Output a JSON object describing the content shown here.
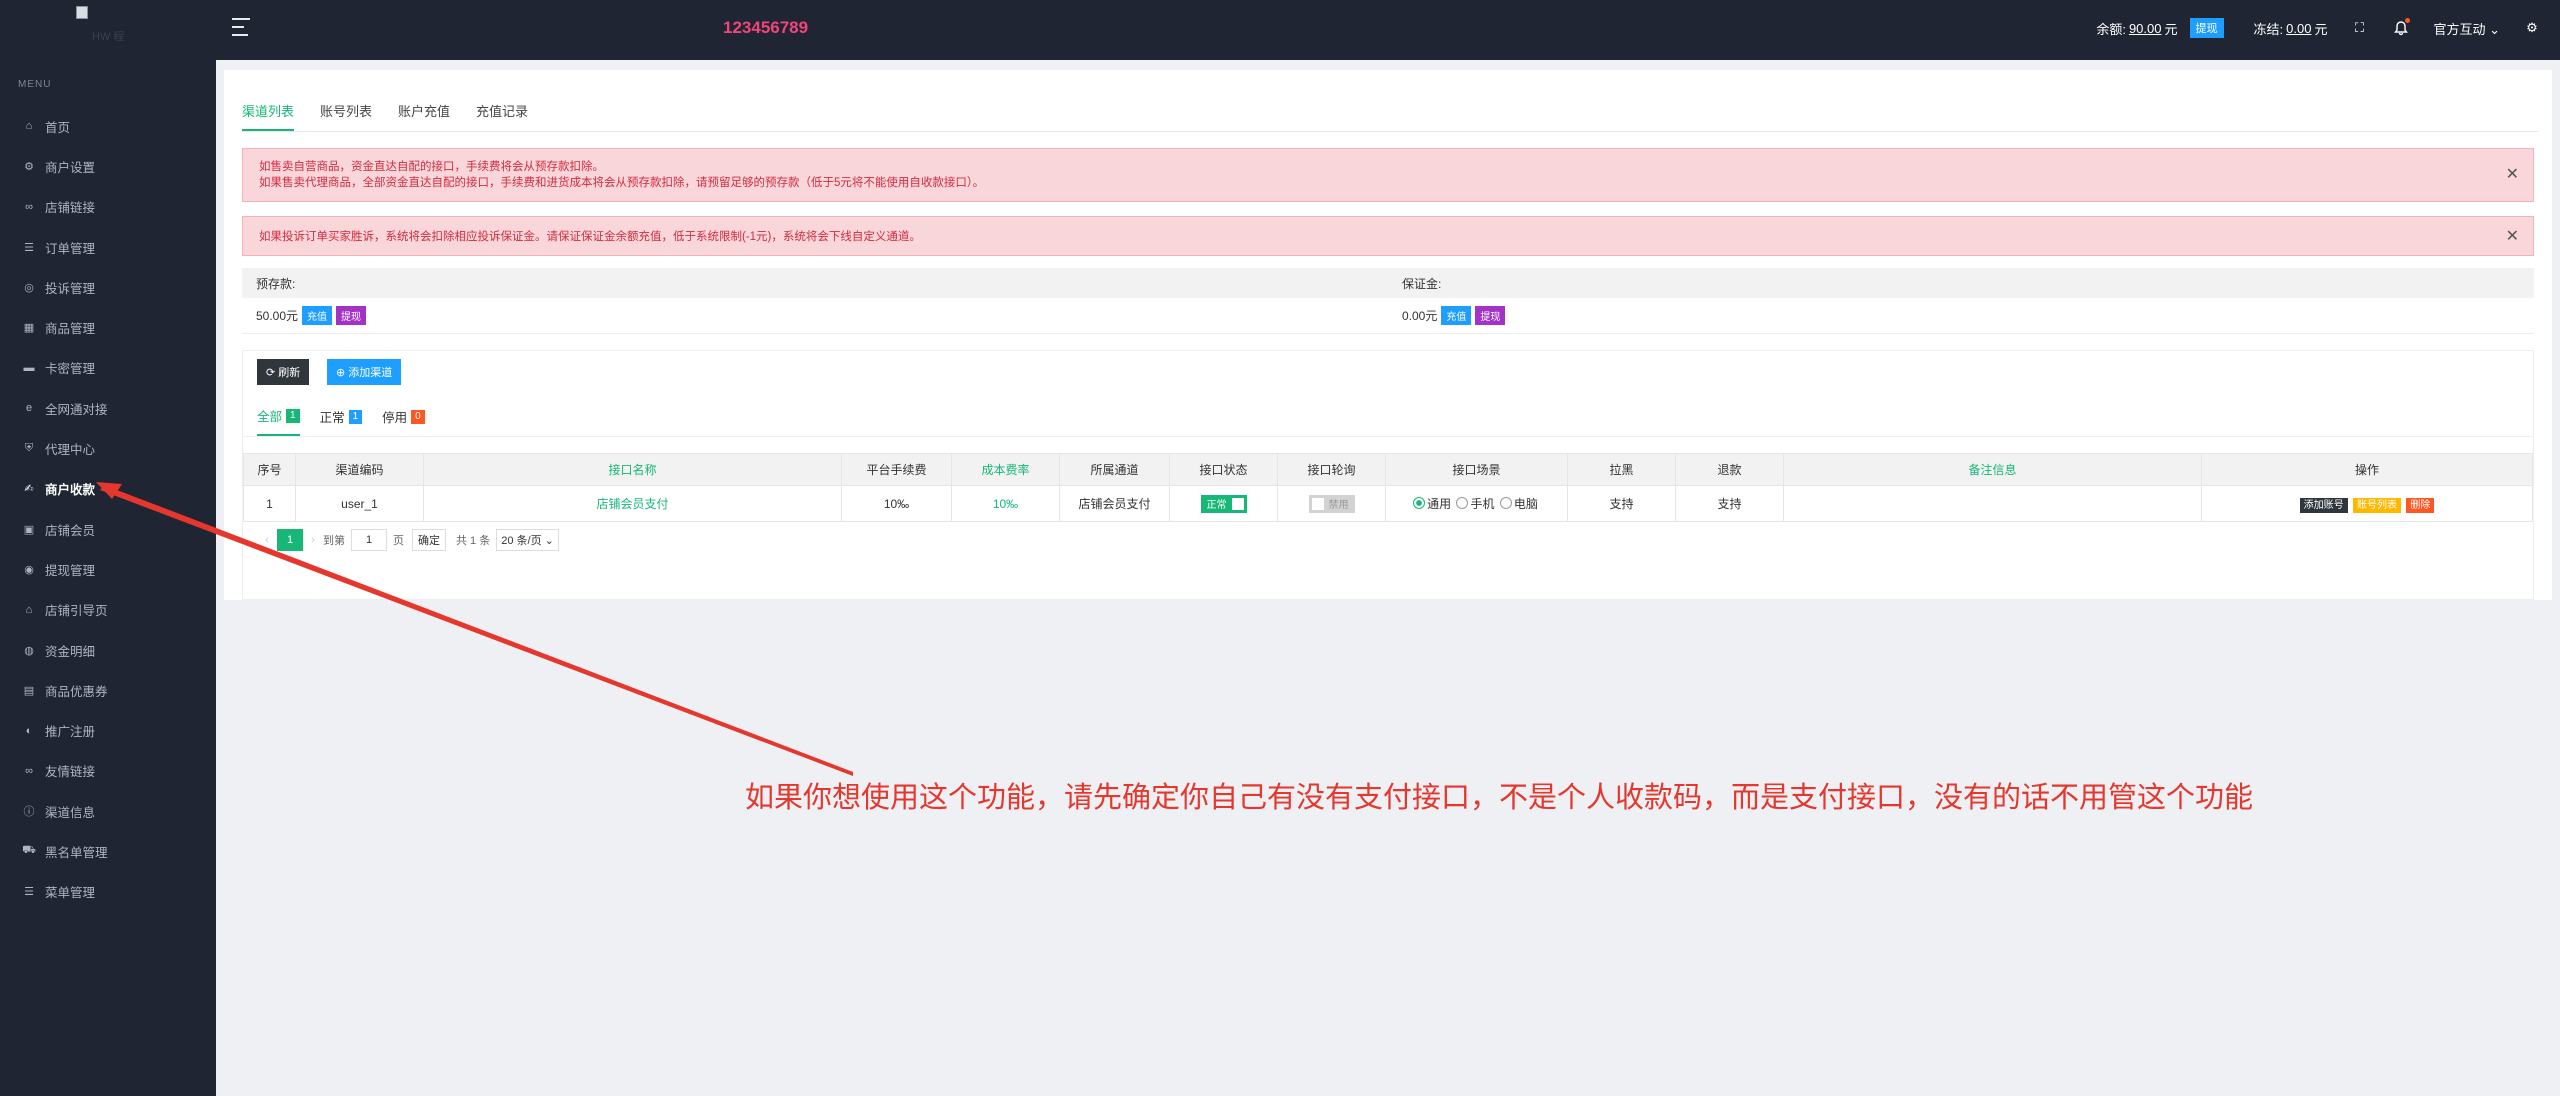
{
  "logo": {
    "alt_text": "HW 程"
  },
  "sidebar": {
    "caption": "MENU",
    "items": [
      {
        "label": "首页",
        "icon": "home-icon"
      },
      {
        "label": "商户设置",
        "icon": "gear-icon"
      },
      {
        "label": "店铺链接",
        "icon": "link-icon"
      },
      {
        "label": "订单管理",
        "icon": "list-icon"
      },
      {
        "label": "投诉管理",
        "icon": "headset-icon"
      },
      {
        "label": "商品管理",
        "icon": "grid-icon"
      },
      {
        "label": "卡密管理",
        "icon": "card-icon"
      },
      {
        "label": "全网通对接",
        "icon": "ie-icon"
      },
      {
        "label": "代理中心",
        "icon": "shield-icon"
      },
      {
        "label": "商户收款",
        "icon": "signature-icon",
        "active": true
      },
      {
        "label": "店铺会员",
        "icon": "member-icon"
      },
      {
        "label": "提现管理",
        "icon": "coin-icon"
      },
      {
        "label": "店铺引导页",
        "icon": "shop-icon"
      },
      {
        "label": "资金明细",
        "icon": "wallet-icon"
      },
      {
        "label": "商品优惠券",
        "icon": "coupon-icon"
      },
      {
        "label": "推广注册",
        "icon": "promote-icon"
      },
      {
        "label": "友情链接",
        "icon": "link-icon"
      },
      {
        "label": "渠道信息",
        "icon": "info-icon"
      },
      {
        "label": "黑名单管理",
        "icon": "car-icon"
      },
      {
        "label": "菜单管理",
        "icon": "menu-icon"
      }
    ]
  },
  "header": {
    "merchant_id": "123456789",
    "balance_label": "余额:",
    "balance_value": "90.00",
    "balance_unit": "元",
    "withdraw_label": "提现",
    "frozen_label": "冻结:",
    "frozen_value": "0.00",
    "frozen_unit": "元",
    "user_name": "官方互动"
  },
  "tabs": [
    "渠道列表",
    "账号列表",
    "账户充值",
    "充值记录"
  ],
  "alerts": {
    "first_line1": "如售卖自营商品，资金直达自配的接口，手续费将会从预存款扣除。",
    "first_line2": "如果售卖代理商品，全部资金直达自配的接口，手续费和进货成本将会从预存款扣除，请预留足够的预存款（低于5元将不能使用自收款接口）。",
    "second": "如果投诉订单买家胜诉，系统将会扣除相应投诉保证金。请保证保证金余额充值，低于系统限制(-1元)，系统将会下线自定义通道。"
  },
  "funds": {
    "prepaid_label": "预存款:",
    "prepaid_value": "50.00元",
    "deposit_label": "保证金:",
    "deposit_value": "0.00元",
    "recharge": "充值",
    "withdraw": "提现"
  },
  "toolbar": {
    "refresh": "刷新",
    "add_channel": "添加渠道"
  },
  "subtabs": [
    {
      "label": "全部",
      "count": "1"
    },
    {
      "label": "正常",
      "count": "1"
    },
    {
      "label": "停用",
      "count": "0"
    }
  ],
  "table": {
    "headers": [
      "序号",
      "渠道编码",
      "接口名称",
      "平台手续费",
      "成本费率",
      "所属通道",
      "接口状态",
      "接口轮询",
      "接口场景",
      "拉黑",
      "退款",
      "备注信息",
      "操作"
    ],
    "rows": [
      {
        "index": "1",
        "code": "user_1",
        "name": "店铺会员支付",
        "fee": "10‰",
        "cost": "10‰",
        "channel": "店铺会员支付",
        "status": "正常",
        "polling": "禁用",
        "scene_all": "通用",
        "scene_mobile": "手机",
        "scene_pc": "电脑",
        "blacklist": "支持",
        "refund": "支持",
        "remark": "",
        "op_add": "添加账号",
        "op_list": "账号列表",
        "op_delete": "删除"
      }
    ]
  },
  "pager": {
    "page": "1",
    "goto_label": "到第",
    "goto_value": "1",
    "page_unit": "页",
    "confirm": "确定",
    "total": "共 1 条",
    "page_size": "20 条/页"
  },
  "annotation": "如果你想使用这个功能，请先确定你自己有没有支付接口，不是个人收款码，而是支付接口，没有的话不用管这个功能",
  "colors": {
    "accent": "#16b777",
    "annotation": "#e5372d",
    "sidebar": "#1f2532"
  }
}
